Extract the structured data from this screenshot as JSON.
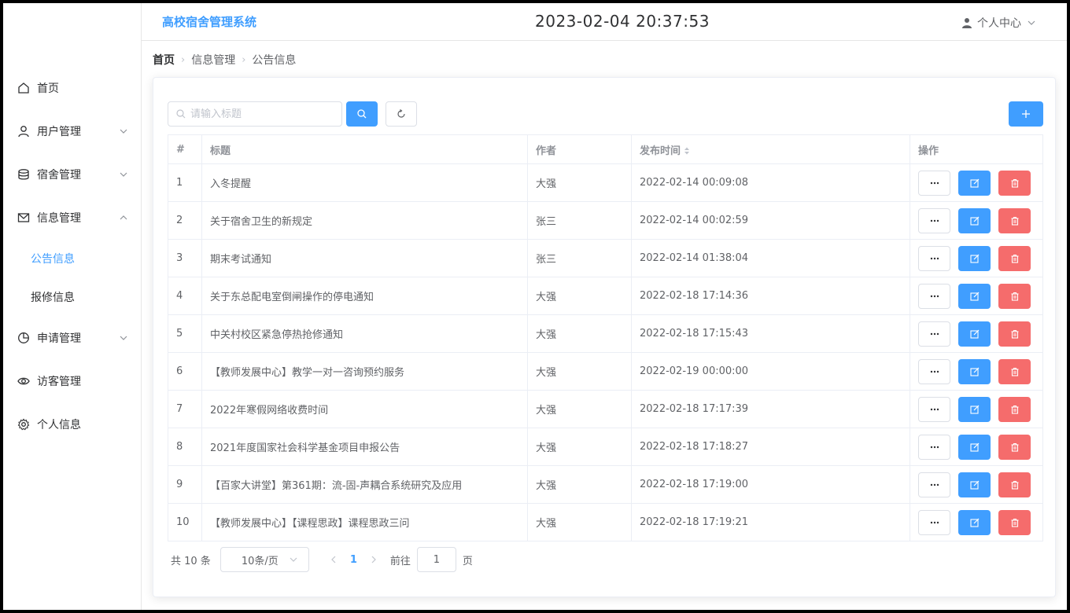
{
  "header": {
    "logo": "高校宿舍管理系统",
    "clock": "2023-02-04 20:37:53",
    "user_label": "个人中心"
  },
  "sidebar": {
    "items": [
      {
        "label": "首页",
        "icon": "home-icon"
      },
      {
        "label": "用户管理",
        "icon": "user-icon",
        "arrow": "down"
      },
      {
        "label": "宿舍管理",
        "icon": "database-icon",
        "arrow": "down"
      },
      {
        "label": "信息管理",
        "icon": "message-icon",
        "arrow": "up"
      },
      {
        "label": "申请管理",
        "icon": "pie-chart-icon",
        "arrow": "down"
      },
      {
        "label": "访客管理",
        "icon": "eye-icon"
      },
      {
        "label": "个人信息",
        "icon": "gear-icon"
      }
    ],
    "sub_items": [
      {
        "label": "公告信息",
        "active": true
      },
      {
        "label": "报修信息",
        "active": false
      }
    ]
  },
  "breadcrumb": [
    "首页",
    "信息管理",
    "公告信息"
  ],
  "search": {
    "placeholder": "请输入标题"
  },
  "table": {
    "columns": [
      "#",
      "标题",
      "作者",
      "发布时间",
      "操作"
    ],
    "rows": [
      {
        "id": "1",
        "title": "入冬提醒",
        "author": "大强",
        "time": "2022-02-14 00:09:08"
      },
      {
        "id": "2",
        "title": "关于宿舍卫生的新规定",
        "author": "张三",
        "time": "2022-02-14 00:02:59"
      },
      {
        "id": "3",
        "title": "期末考试通知",
        "author": "张三",
        "time": "2022-02-14 01:38:04"
      },
      {
        "id": "4",
        "title": "关于东总配电室倒闸操作的停电通知",
        "author": "大强",
        "time": "2022-02-18 17:14:36"
      },
      {
        "id": "5",
        "title": "中关村校区紧急停热抢修通知",
        "author": "大强",
        "time": "2022-02-18 17:15:43"
      },
      {
        "id": "6",
        "title": "【教师发展中心】教学一对一咨询预约服务",
        "author": "大强",
        "time": "2022-02-19 00:00:00"
      },
      {
        "id": "7",
        "title": "2022年寒假网络收费时间",
        "author": "大强",
        "time": "2022-02-18 17:17:39"
      },
      {
        "id": "8",
        "title": "2021年度国家社会科学基金项目申报公告",
        "author": "大强",
        "time": "2022-02-18 17:18:27"
      },
      {
        "id": "9",
        "title": "【百家大讲堂】第361期：流-固-声耦合系统研究及应用",
        "author": "大强",
        "time": "2022-02-18 17:19:00"
      },
      {
        "id": "10",
        "title": "【教师发展中心】【课程思政】课程思政三问",
        "author": "大强",
        "time": "2022-02-18 17:19:21"
      }
    ]
  },
  "pagination": {
    "total": "共 10 条",
    "page_size": "10条/页",
    "current_page": "1",
    "goto_label": "前往",
    "goto_value": "1",
    "page_suffix": "页"
  },
  "colors": {
    "primary": "#409eff",
    "danger": "#f56c6c"
  }
}
